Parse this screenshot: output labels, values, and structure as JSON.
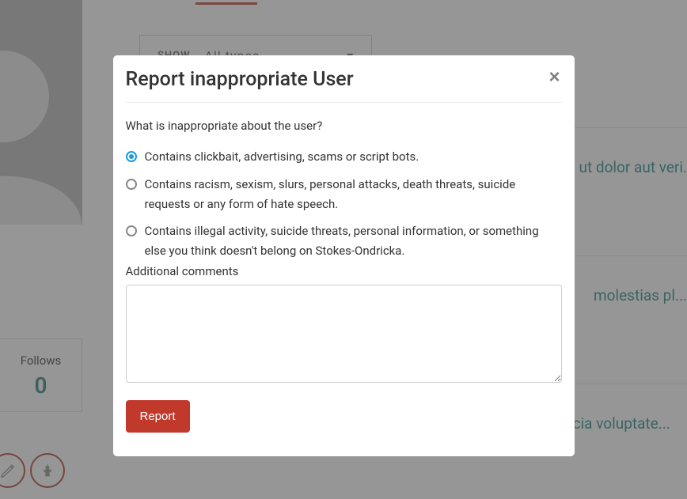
{
  "sidebar": {
    "follows_label": "Follows",
    "follows_count": "0"
  },
  "filter": {
    "label": "SHOW",
    "selected": "All types"
  },
  "posts": [
    "ut dolor aut veri.",
    "molestias pl...",
    "Ratione voluptatem facilis voluptas enim omnis et qui vitae ex officia voluptate..."
  ],
  "modal": {
    "title": "Report inappropriate User",
    "question": "What is inappropriate about the user?",
    "options": [
      "Contains clickbait, advertising, scams or script bots.",
      "Contains racism, sexism, slurs, personal attacks, death threats, suicide requests or any form of hate speech.",
      "Contains illegal activity, suicide threats, personal information, or something else you think doesn't belong on Stokes-Ondricka."
    ],
    "comments_label": "Additional comments",
    "report_label": "Report"
  }
}
